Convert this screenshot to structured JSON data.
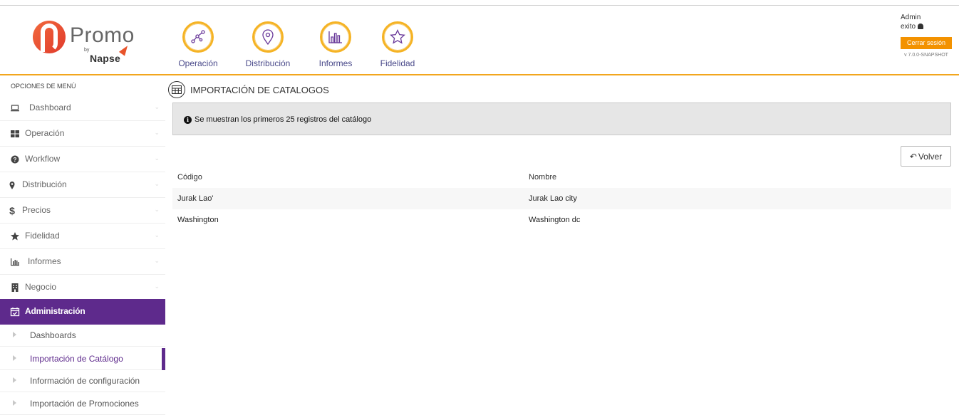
{
  "header": {
    "logo": {
      "word": "Promo",
      "by": "by",
      "brand": "Napse"
    },
    "modules": [
      {
        "label": "Operación",
        "icon": "operacion-icon"
      },
      {
        "label": "Distribución",
        "icon": "distribucion-icon"
      },
      {
        "label": "Informes",
        "icon": "informes-icon"
      },
      {
        "label": "Fidelidad",
        "icon": "fidelidad-icon"
      }
    ],
    "user": {
      "name": "Admin",
      "company": "exito",
      "logout_label": "Cerrar sesión",
      "version": "v 7.0.0-SNAPSHOT"
    },
    "colors": {
      "accent": "#f2a61d",
      "logout": "#f39200",
      "module_ring": "#f5b324"
    }
  },
  "sidebar": {
    "title": "OPCIONES DE MENÚ",
    "items": [
      {
        "label": "Dashboard",
        "icon": "laptop-icon"
      },
      {
        "label": "Operación",
        "icon": "grid-icon"
      },
      {
        "label": "Workflow",
        "icon": "question-circle-icon"
      },
      {
        "label": "Distribución",
        "icon": "map-marker-icon"
      },
      {
        "label": "Precios",
        "icon": "dollar-icon"
      },
      {
        "label": "Fidelidad",
        "icon": "star-icon"
      },
      {
        "label": "Informes",
        "icon": "bar-chart-icon"
      },
      {
        "label": "Negocio",
        "icon": "building-icon"
      },
      {
        "label": "Administración",
        "icon": "calendar-check-icon",
        "active": true
      }
    ],
    "sub_items": [
      {
        "label": "Dashboards"
      },
      {
        "label": "Importación de Catálogo",
        "selected": true
      },
      {
        "label": "Información de configuración"
      },
      {
        "label": "Importación de Promociones"
      }
    ],
    "colors": {
      "active": "#5e2a8c"
    }
  },
  "main": {
    "title": "IMPORTACIÓN DE CATALOGOS",
    "info_message": "Se muestran los primeros 25 registros del catálogo",
    "back_label": "Volver",
    "table": {
      "headers": [
        "Código",
        "Nombre"
      ],
      "rows": [
        [
          "Jurak Lao'",
          "Jurak Lao city"
        ],
        [
          "Washington",
          "Washington dc"
        ]
      ]
    }
  }
}
